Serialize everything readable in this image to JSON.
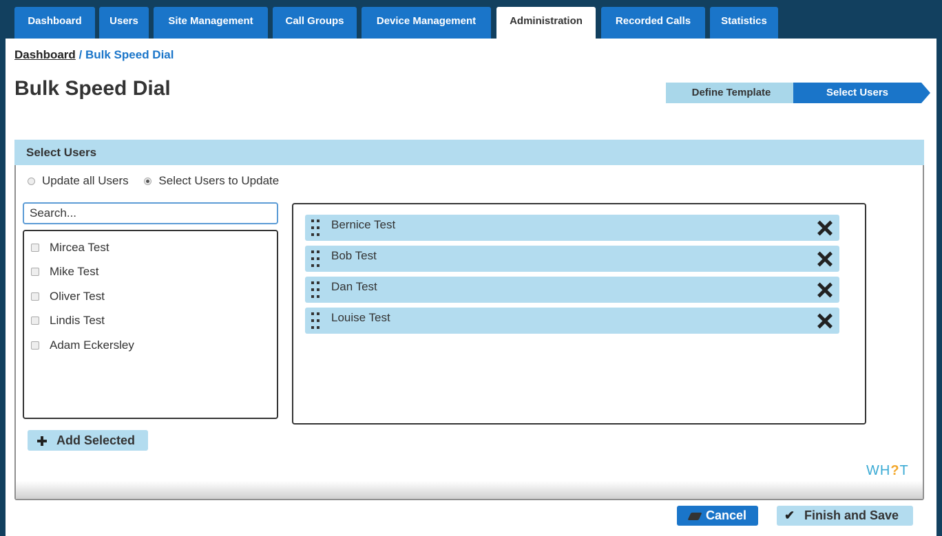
{
  "tabs": [
    {
      "label": "Dashboard",
      "active": false
    },
    {
      "label": "Users",
      "active": false
    },
    {
      "label": "Site Management",
      "active": false
    },
    {
      "label": "Call Groups",
      "active": false
    },
    {
      "label": "Device Management",
      "active": false
    },
    {
      "label": "Administration",
      "active": true
    },
    {
      "label": "Recorded Calls",
      "active": false
    },
    {
      "label": "Statistics",
      "active": false
    }
  ],
  "breadcrumb": {
    "home": "Dashboard",
    "separator": "/",
    "current": "Bulk Speed Dial"
  },
  "page_title": "Bulk Speed Dial",
  "wizard": {
    "steps": [
      "Define Template",
      "Select Users"
    ],
    "current_step": "Select Users"
  },
  "panel": {
    "title": "Select Users",
    "radio_options": [
      {
        "label": "Update all Users",
        "checked": false
      },
      {
        "label": "Select Users to Update",
        "checked": true
      }
    ],
    "search_placeholder": "Search...",
    "available_users": [
      {
        "name": "Mircea Test",
        "checked": false
      },
      {
        "name": "Mike Test",
        "checked": false
      },
      {
        "name": "Oliver Test",
        "checked": false
      },
      {
        "name": "Lindis Test",
        "checked": false
      },
      {
        "name": "Adam Eckersley",
        "checked": false
      }
    ],
    "add_button": "Add Selected",
    "selected_users": [
      "Bernice Test",
      "Bob Test",
      "Dan Test",
      "Louise Test"
    ],
    "logo": {
      "part1": "WH",
      "part2": "?",
      "part3": "T"
    }
  },
  "actions": {
    "cancel": "Cancel",
    "finish": "Finish and Save"
  },
  "colors": {
    "primary": "#1a75c9",
    "header_bg": "#12405f",
    "light_blue": "#b3dcef",
    "logo_blue": "#3aaad4",
    "logo_orange": "#f3a72a"
  }
}
